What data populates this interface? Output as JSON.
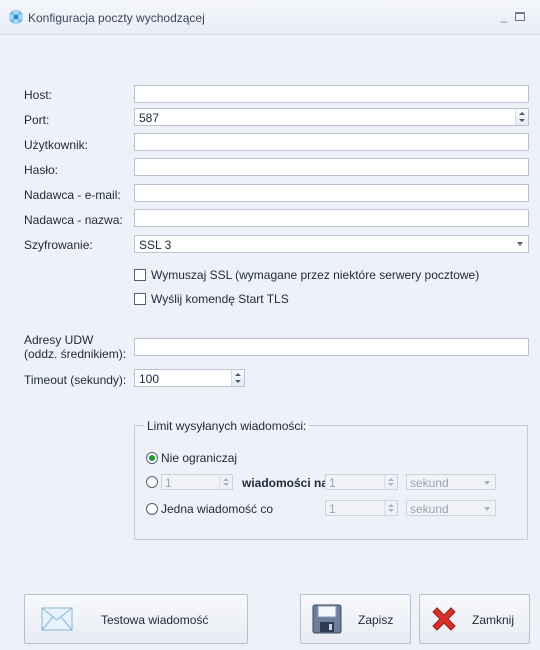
{
  "window": {
    "title": "Konfiguracja poczty wychodzącej",
    "minimize_glyph": "_",
    "icon": "gear-flower-icon"
  },
  "form": {
    "host": {
      "label": "Host:",
      "value": ""
    },
    "port": {
      "label": "Port:",
      "value": "587"
    },
    "user": {
      "label": "Użytkownik:",
      "value": ""
    },
    "password": {
      "label": "Hasło:",
      "value": ""
    },
    "sender_email": {
      "label": "Nadawca - e-mail:",
      "value": ""
    },
    "sender_name": {
      "label": "Nadawca - nazwa:",
      "value": ""
    },
    "encryption": {
      "label": "Szyfrowanie:",
      "value": "SSL 3"
    },
    "force_ssl": {
      "label": "Wymuszaj SSL (wymagane przez niektóre serwery pocztowe)",
      "checked": false
    },
    "start_tls": {
      "label": "Wyślij komendę Start TLS",
      "checked": false
    },
    "bcc": {
      "label_line1": "Adresy UDW",
      "label_line2": "(oddz. średnikiem):",
      "value": ""
    },
    "timeout": {
      "label": "Timeout (sekundy):",
      "value": "100"
    }
  },
  "limit": {
    "title": "Limit wysyłanych wiadomości:",
    "no_limit": {
      "label": "Nie ograniczaj",
      "selected": true
    },
    "per_period": {
      "count": "1",
      "middle_label": "wiadomości na",
      "period_value": "1",
      "unit": "sekund",
      "selected": false
    },
    "one_every": {
      "label": "Jedna wiadomość co",
      "period_value": "1",
      "unit": "sekund",
      "selected": false
    }
  },
  "buttons": {
    "test": {
      "label": "Testowa wiadomość",
      "icon": "envelope-icon"
    },
    "save": {
      "label": "Zapisz",
      "icon": "floppy-disk-icon"
    },
    "close": {
      "label": "Zamknij",
      "icon": "red-x-icon"
    }
  },
  "colors": {
    "radio_selected": "#1e9c2a",
    "close_icon": "#d9302c",
    "background": "#eef1f7"
  }
}
